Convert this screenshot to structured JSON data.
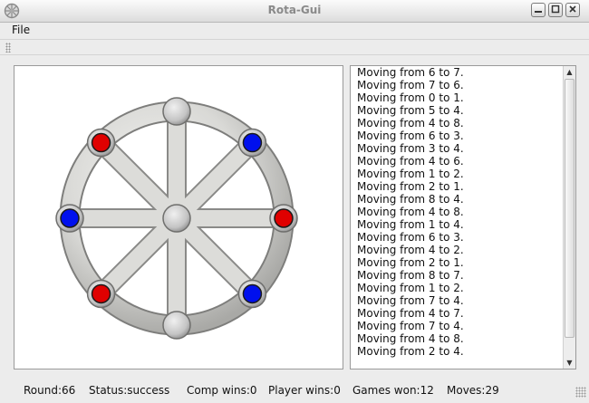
{
  "window": {
    "title": "Rota-Gui"
  },
  "menu": {
    "file": "File"
  },
  "icons": {
    "app": "wheel-icon",
    "minimize": "minimize-icon",
    "maximize": "maximize-icon",
    "close": "close-icon"
  },
  "board": {
    "player_colors": {
      "player1": "#e00000",
      "player2": "#0010ee"
    },
    "positions": [
      {
        "id": "top",
        "piece": "empty"
      },
      {
        "id": "top-right",
        "piece": "blue"
      },
      {
        "id": "right",
        "piece": "red"
      },
      {
        "id": "bottom-right",
        "piece": "blue"
      },
      {
        "id": "bottom",
        "piece": "empty"
      },
      {
        "id": "bottom-left",
        "piece": "red"
      },
      {
        "id": "left",
        "piece": "blue"
      },
      {
        "id": "top-left",
        "piece": "red"
      },
      {
        "id": "center",
        "piece": "empty"
      }
    ]
  },
  "log": [
    "Moving from 6 to 7.",
    "Moving from 7 to 6.",
    "Moving from 0 to 1.",
    "Moving from 5 to 4.",
    "Moving from 4 to 8.",
    "Moving from 6 to 3.",
    "Moving from 3 to 4.",
    "Moving from 4 to 6.",
    "Moving from 1 to 2.",
    "Moving from 2 to 1.",
    "Moving from 8 to 4.",
    "Moving from 4 to 8.",
    "Moving from 1 to 4.",
    "Moving from 6 to 3.",
    "Moving from 4 to 2.",
    "Moving from 2 to 1.",
    "Moving from 8 to 7.",
    "Moving from 1 to 2.",
    "Moving from 7 to 4.",
    "Moving from 4 to 7.",
    "Moving from 7 to 4.",
    "Moving from 4 to 8.",
    "Moving from 2 to 4."
  ],
  "status": {
    "round": "Round:66",
    "status": "Status:success",
    "comp_wins": "Comp wins:0",
    "player_wins": "Player wins:0",
    "games_won": "Games won:12",
    "moves": "Moves:29"
  }
}
